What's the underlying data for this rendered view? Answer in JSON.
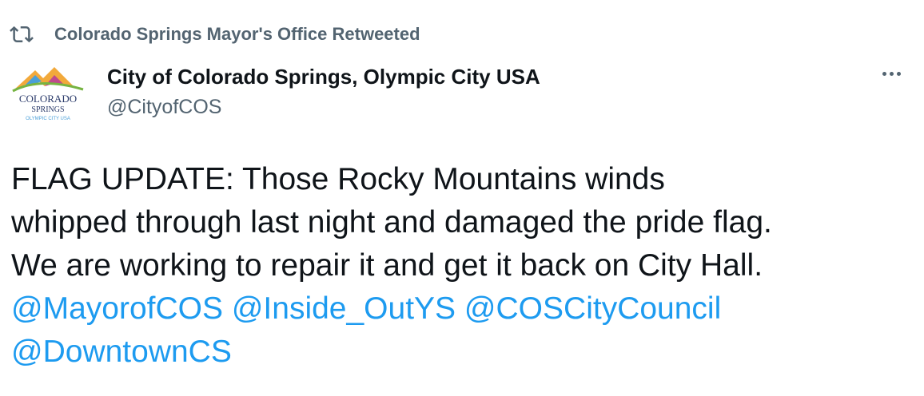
{
  "retweet": {
    "icon": "retweet-icon",
    "label": "Colorado Springs Mayor's Office Retweeted"
  },
  "author": {
    "avatar_icon": "colorado-springs-logo",
    "avatar_text_line1": "COLORADO",
    "avatar_text_line2": "SPRINGS",
    "avatar_text_line3": "OLYMPIC CITY USA",
    "display_name": "City of Colorado Springs, Olympic City USA",
    "handle": "@CityofCOS"
  },
  "more_icon": "more-options-icon",
  "tweet": {
    "line1": "FLAG UPDATE: Those Rocky Mountains winds",
    "line2": "whipped through last night and damaged the pride flag.",
    "line3": "We are working to repair it and get it back on City Hall.",
    "mentions": [
      "@MayorofCOS",
      "@Inside_OutYS",
      "@COSCityCouncil",
      "@DowntownCS"
    ]
  },
  "colors": {
    "mention": "#1d9bf0",
    "secondary_text": "#536471",
    "primary_text": "#0f1419"
  }
}
